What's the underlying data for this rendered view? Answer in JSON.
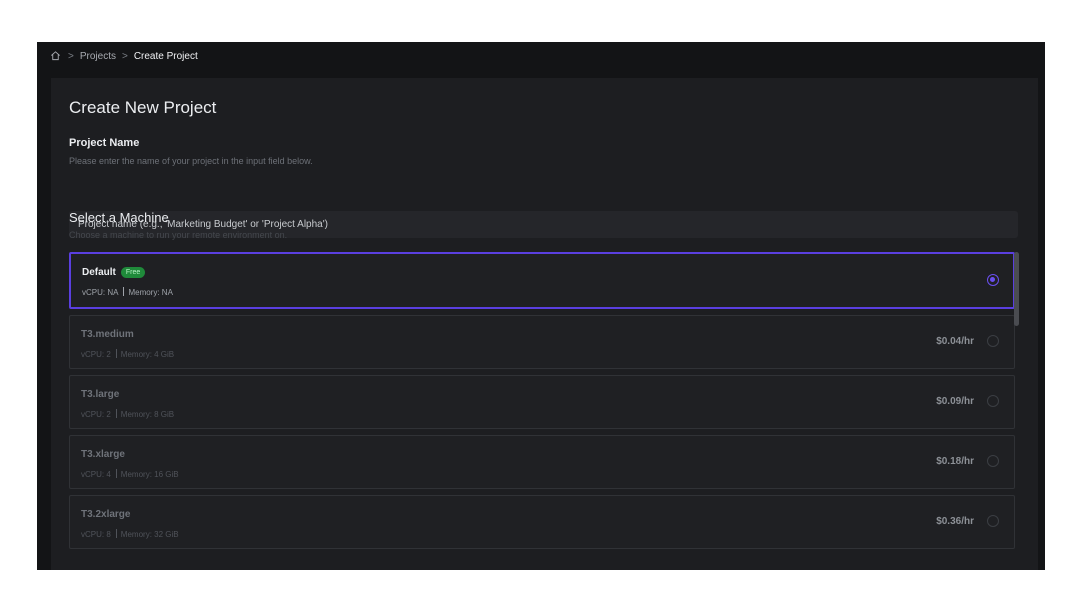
{
  "breadcrumb": {
    "home_icon": "home-icon",
    "items": [
      "Projects",
      "Create Project"
    ],
    "separator": ">"
  },
  "page": {
    "title": "Create New Project"
  },
  "project_name": {
    "label": "Project Name",
    "hint": "Please enter the name of your project in the input field below.",
    "placeholder": "Project name (e.g., 'Marketing Budget' or 'Project Alpha')",
    "value": ""
  },
  "machine_section": {
    "title": "Select a Machine",
    "hint": "Choose a machine to run your remote environment on.",
    "machines": [
      {
        "name": "Default",
        "badge": "Free",
        "vcpu": "vCPU: NA",
        "memory": "Memory: NA",
        "price": "",
        "selected": true
      },
      {
        "name": "T3.medium",
        "badge": "",
        "vcpu": "vCPU: 2",
        "memory": "Memory: 4 GiB",
        "price": "$0.04/hr",
        "selected": false
      },
      {
        "name": "T3.large",
        "badge": "",
        "vcpu": "vCPU: 2",
        "memory": "Memory: 8 GiB",
        "price": "$0.09/hr",
        "selected": false
      },
      {
        "name": "T3.xlarge",
        "badge": "",
        "vcpu": "vCPU: 4",
        "memory": "Memory: 16 GiB",
        "price": "$0.18/hr",
        "selected": false
      },
      {
        "name": "T3.2xlarge",
        "badge": "",
        "vcpu": "vCPU: 8",
        "memory": "Memory: 32 GiB",
        "price": "$0.36/hr",
        "selected": false
      }
    ]
  },
  "colors": {
    "accent": "#5a3fe0",
    "free_badge": "#1f8a3a",
    "background": "#131416",
    "panel": "#1d1e21"
  }
}
